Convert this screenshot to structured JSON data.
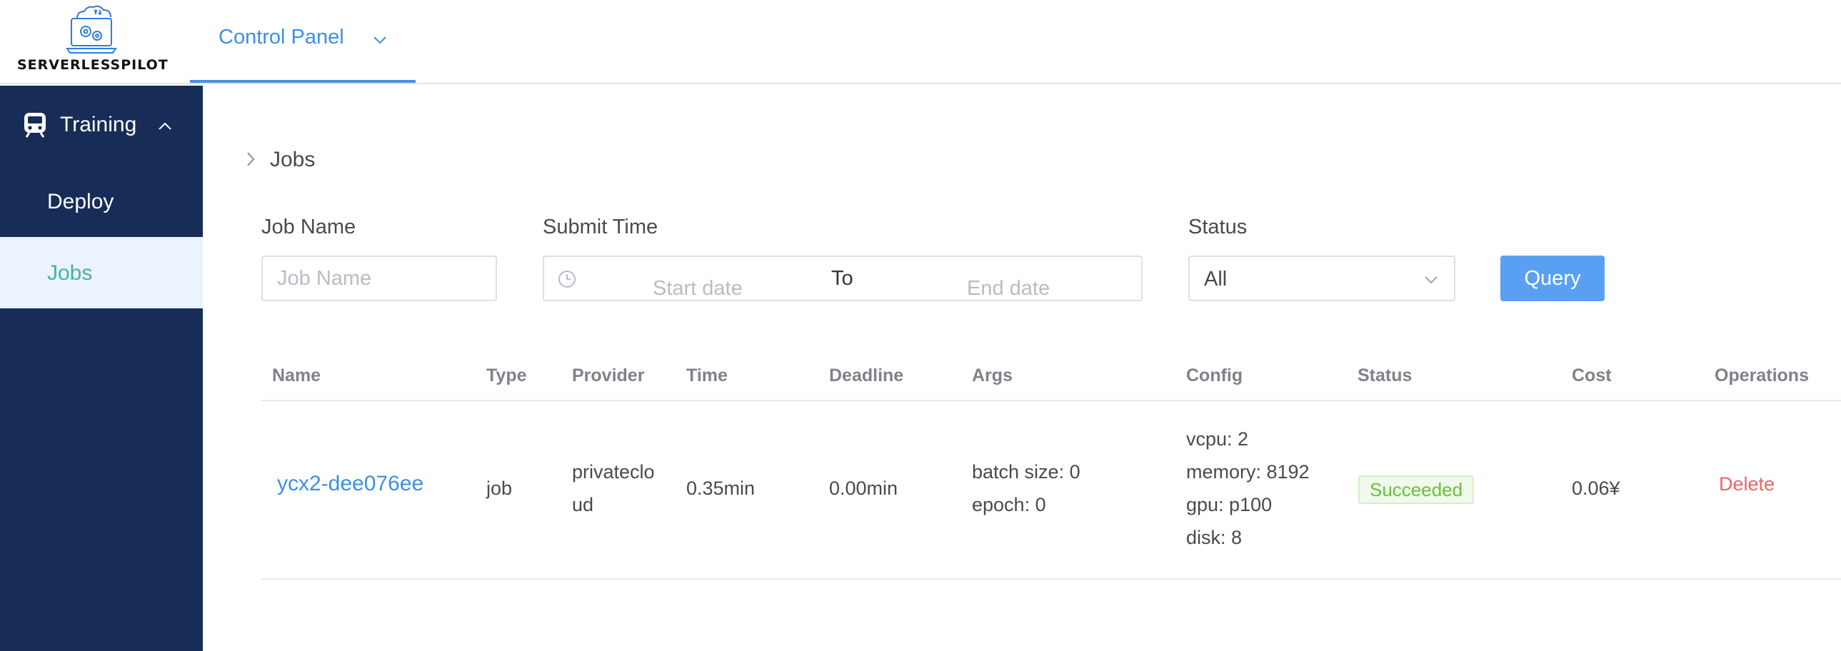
{
  "app": {
    "logo_text": "SERVERLESSPILOT"
  },
  "header": {
    "tab_label": "Control Panel"
  },
  "sidebar": {
    "group_label": "Training",
    "items": [
      {
        "label": "Deploy"
      },
      {
        "label": "Jobs"
      }
    ]
  },
  "breadcrumb": {
    "current": "Jobs"
  },
  "filters": {
    "job_name_label": "Job Name",
    "job_name_placeholder": "Job Name",
    "submit_time_label": "Submit Time",
    "start_placeholder": "Start date",
    "range_separator": "To",
    "end_placeholder": "End date",
    "status_label": "Status",
    "status_value": "All",
    "query_label": "Query"
  },
  "table": {
    "columns": [
      "Name",
      "Type",
      "Provider",
      "Time",
      "Deadline",
      "Args",
      "Config",
      "Status",
      "Cost",
      "Operations"
    ],
    "rows": [
      {
        "name": "ycx2-dee076ee",
        "type": "job",
        "provider_line1": "privateclo",
        "provider_line2": "ud",
        "time": "0.35min",
        "deadline": "0.00min",
        "args": [
          "batch size: 0",
          "epoch: 0"
        ],
        "config": [
          "vcpu: 2",
          "memory: 8192",
          "gpu: p100",
          "disk: 8"
        ],
        "status": "Succeeded",
        "cost": "0.06¥",
        "operation": "Delete"
      }
    ]
  },
  "colors": {
    "accent": "#3d8fe6",
    "sidebar_bg": "#172d58",
    "active_item_bg": "#eaf3fe",
    "active_item_text": "#4ab393",
    "success": "#67c23a",
    "danger": "#ee6464"
  },
  "icons": {
    "logo": "laptop-cloud-gears-icon",
    "tab_dropdown": "chevron-down-icon",
    "training": "train-icon",
    "group_toggle": "chevron-up-icon",
    "breadcrumb": "chevron-right-icon",
    "date": "clock-icon",
    "select": "chevron-down-icon"
  }
}
